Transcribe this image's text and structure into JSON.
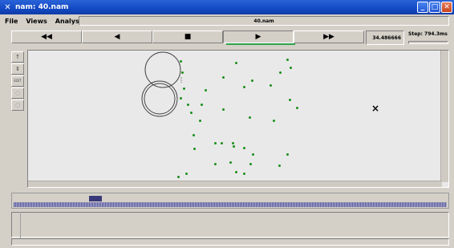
{
  "window": {
    "title": "nam: 40.nam",
    "min_label": "_",
    "max_label": "□",
    "close_label": "✕"
  },
  "menu": {
    "file": "File",
    "views": "Views",
    "analysis": "Analysis",
    "file_name": "40.nam"
  },
  "controls": {
    "rewind": "◀◀",
    "back": "◀",
    "stop": "■",
    "play": "▶",
    "forward": "▶▶",
    "time": "34.486666",
    "step": "Step: 794.3ms"
  },
  "tools": [
    "↑",
    "⇕",
    "EDIT",
    "○",
    "○"
  ],
  "canvas": {
    "cross": "×"
  },
  "timeline": {
    "marker": ""
  }
}
